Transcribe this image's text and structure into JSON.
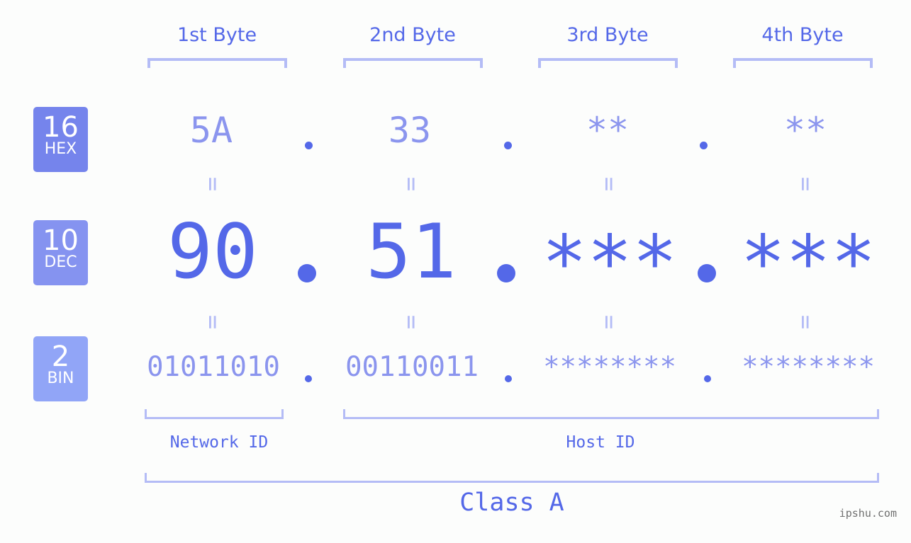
{
  "bytes": [
    {
      "header": "1st Byte",
      "hex": "5A",
      "dec": "90",
      "bin": "01011010"
    },
    {
      "header": "2nd Byte",
      "hex": "33",
      "dec": "51",
      "bin": "00110011"
    },
    {
      "header": "3rd Byte",
      "hex": "**",
      "dec": "***",
      "bin": "********"
    },
    {
      "header": "4th Byte",
      "hex": "**",
      "dec": "***",
      "bin": "********"
    }
  ],
  "badges": {
    "hex": {
      "num": "16",
      "label": "HEX",
      "color": "#7584ec"
    },
    "dec": {
      "num": "10",
      "label": "DEC",
      "color": "#8593f0"
    },
    "bin": {
      "num": "2",
      "label": "BIN",
      "color": "#91a5f7"
    }
  },
  "equals_sign": "=",
  "labels": {
    "network_id": "Network ID",
    "host_id": "Host ID",
    "class": "Class A"
  },
  "watermark": "ipshu.com",
  "colors": {
    "accent": "#5468e8",
    "light_text": "#8b95ee",
    "bracket": "#b4bcf6",
    "background": "#fcfdfc"
  }
}
